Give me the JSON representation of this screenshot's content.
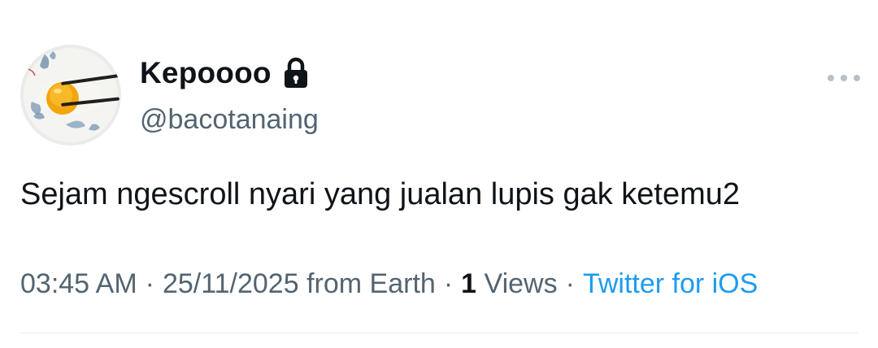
{
  "author": {
    "display_name": "Kepoooo",
    "handle": "@bacotanaing",
    "protected_icon": "lock-icon",
    "avatar_icon": "egg-yolk-bowl-avatar"
  },
  "more_icon": "more-horizontal-icon",
  "tweet": {
    "text": "Sejam ngescroll nyari yang jualan lupis gak ketemu2"
  },
  "meta": {
    "time": "03:45 AM",
    "date": "25/11/2025",
    "location": "from Earth",
    "separator": "·",
    "views_count": "1",
    "views_label": "Views",
    "source": "Twitter for iOS"
  },
  "colors": {
    "text_primary": "#0f1419",
    "text_secondary": "#536471",
    "link": "#1d9bf0",
    "divider": "#e6e9ec"
  }
}
